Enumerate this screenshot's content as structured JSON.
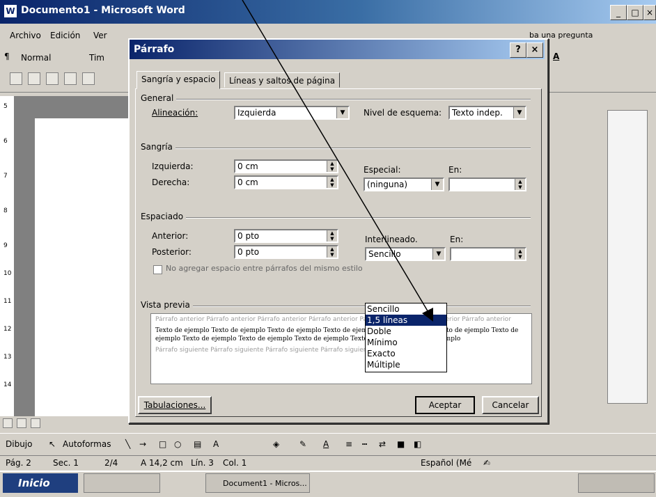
{
  "window": {
    "title": "Documento1 - Microsoft Word"
  },
  "menubar": {
    "items": [
      "Archivo",
      "Edición",
      "Ver"
    ],
    "help_placeholder": "ba una pregunta"
  },
  "toolbar": {
    "style": "Normal",
    "font": "Tim"
  },
  "dialog": {
    "title": "Párrafo",
    "tabs": [
      "Sangría y espacio",
      "Líneas y saltos de página"
    ],
    "general": {
      "group": "General",
      "alignment_label": "Alineación:",
      "alignment_value": "Izquierda",
      "outline_label": "Nivel de esquema:",
      "outline_value": "Texto indep."
    },
    "indent": {
      "group": "Sangría",
      "left_label": "Izquierda:",
      "left_value": "0 cm",
      "right_label": "Derecha:",
      "right_value": "0 cm",
      "special_label": "Especial:",
      "special_value": "(ninguna)",
      "by_label": "En:",
      "by_value": ""
    },
    "spacing": {
      "group": "Espaciado",
      "before_label": "Anterior:",
      "before_value": "0 pto",
      "after_label": "Posterior:",
      "after_value": "0 pto",
      "line_label": "Interlineado.",
      "line_value": "Sencillo",
      "at_label": "En:",
      "at_value": "",
      "checkbox_label": "No agregar espacio entre párrafos del mismo estilo",
      "options": [
        "Sencillo",
        "1,5 líneas",
        "Doble",
        "Mínimo",
        "Exacto",
        "Múltiple"
      ],
      "selected_option_index": 1
    },
    "preview": {
      "group": "Vista previa",
      "gray_top": "Párrafo anterior Párrafo anterior Párrafo anterior Párrafo anterior Párrafo anterior Párrafo anterior Párrafo anterior",
      "sample": "Texto de ejemplo Texto de ejemplo Texto de ejemplo Texto de ejemplo Texto de ejemplo Texto de ejemplo Texto de ejemplo Texto de ejemplo Texto de ejemplo Texto de ejemplo Texto de ejemplo Texto de ejemplo",
      "gray_bottom": "Párrafo siguiente Párrafo siguiente Párrafo siguiente Párrafo siguiente Párrafo siguiente"
    },
    "buttons": {
      "tabs": "Tabulaciones...",
      "ok": "Aceptar",
      "cancel": "Cancelar"
    }
  },
  "drawbar": {
    "draw": "Dibujo",
    "autoshapes": "Autoformas"
  },
  "statusbar": {
    "page": "Pág. 2",
    "section": "Sec. 1",
    "pages": "2/4",
    "at": "A 14,2 cm",
    "line": "Lín. 3",
    "col": "Col. 1",
    "lang": "Español (Mé"
  },
  "taskbar": {
    "start": "Inicio",
    "item1": "Document1 - Micros..."
  },
  "colors": {
    "titlebar": "#0a246a",
    "selection": "#0a246a",
    "face": "#d4d0c8"
  }
}
